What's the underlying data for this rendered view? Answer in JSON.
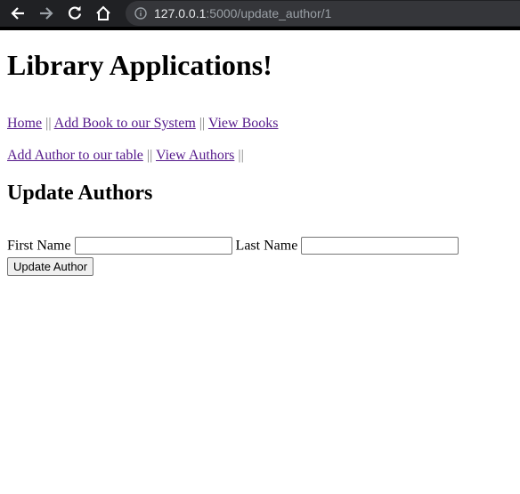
{
  "browser": {
    "url_host": "127.0.0.1",
    "url_path": ":5000/update_author/1",
    "icons": [
      "back-arrow-icon",
      "forward-arrow-icon",
      "reload-icon",
      "home-icon",
      "info-icon"
    ]
  },
  "page": {
    "title": "Library Applications!",
    "nav_row1": [
      {
        "label": "Home"
      },
      {
        "label": "Add Book to our System"
      },
      {
        "label": "View Books"
      }
    ],
    "nav_row2": [
      {
        "label": "Add Author to our table"
      },
      {
        "label": "View Authors"
      }
    ],
    "separator": "||",
    "heading": "Update Authors",
    "form": {
      "first_name_label": "First Name",
      "first_name_value": "",
      "last_name_label": "Last Name",
      "last_name_value": "",
      "submit_label": "Update Author"
    }
  },
  "colors": {
    "link": "#551a8b",
    "separator": "#808080",
    "toolbar_bg": "#202124"
  }
}
